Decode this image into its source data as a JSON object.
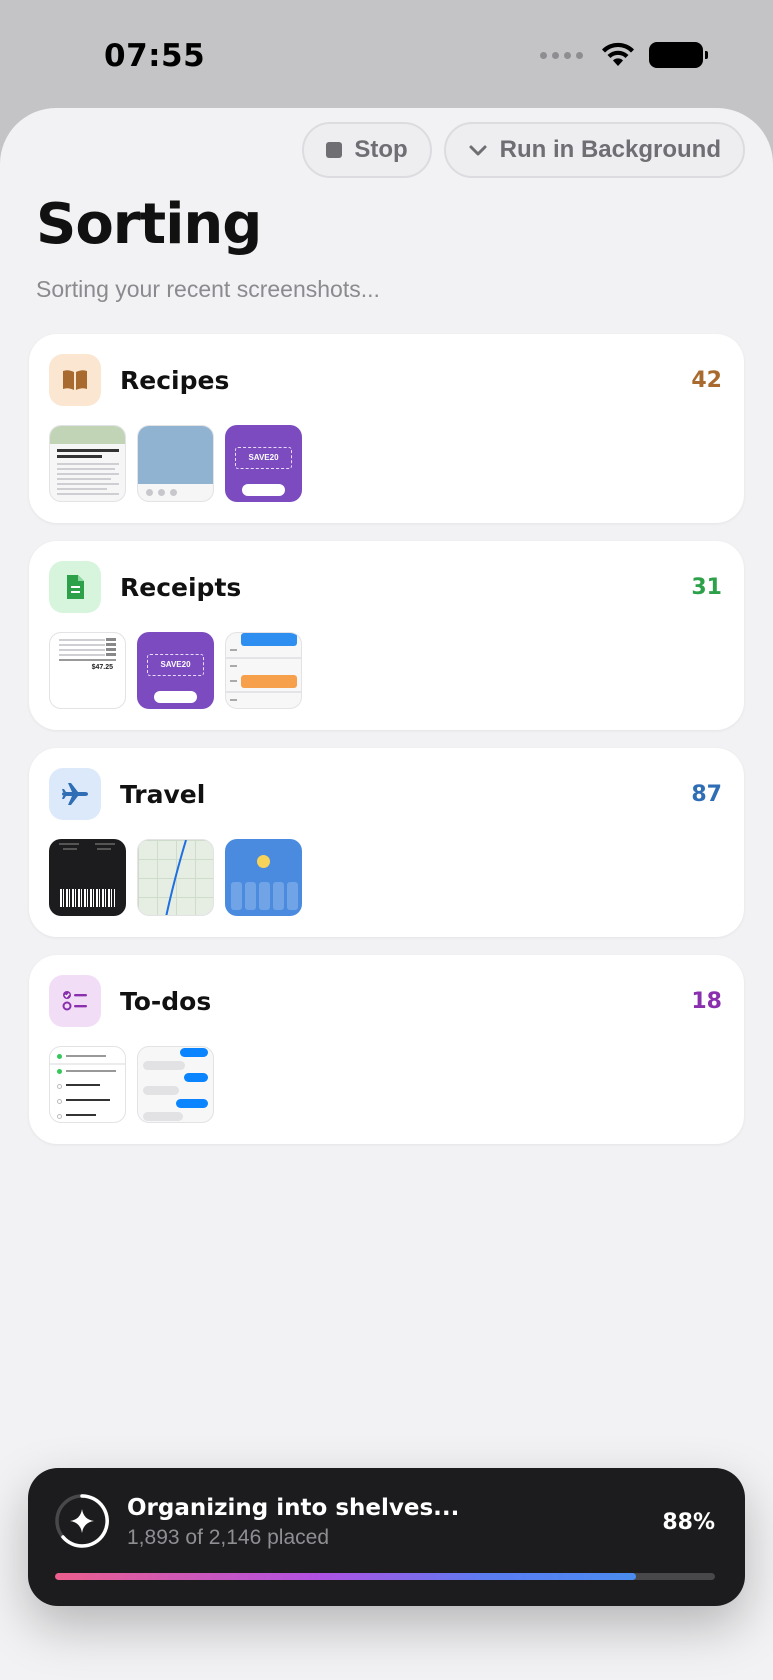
{
  "status_bar": {
    "time": "07:55"
  },
  "actions": {
    "stop_label": "Stop",
    "background_label": "Run in Background"
  },
  "header": {
    "title": "Sorting",
    "subtitle": "Sorting your recent screenshots..."
  },
  "shelves": [
    {
      "name": "Recipes",
      "count": "42",
      "icon": "book-icon",
      "color": "#a86a2e",
      "icon_bg": "#fbe6d2"
    },
    {
      "name": "Receipts",
      "count": "31",
      "icon": "document-icon",
      "color": "#2da14a",
      "icon_bg": "#d6f5dc"
    },
    {
      "name": "Travel",
      "count": "87",
      "icon": "airplane-icon",
      "color": "#2f6db5",
      "icon_bg": "#dbe9fb"
    },
    {
      "name": "To-dos",
      "count": "18",
      "icon": "checklist-icon",
      "color": "#8a2fad",
      "icon_bg": "#f2ddf7"
    }
  ],
  "thumbnails": {
    "coupon_code": "SAVE20",
    "receipt_amount": "$47.25"
  },
  "progress": {
    "title": "Organizing into shelves...",
    "detail": "1,893 of 2,146 placed",
    "percent_label": "88%",
    "fraction": 0.88
  }
}
